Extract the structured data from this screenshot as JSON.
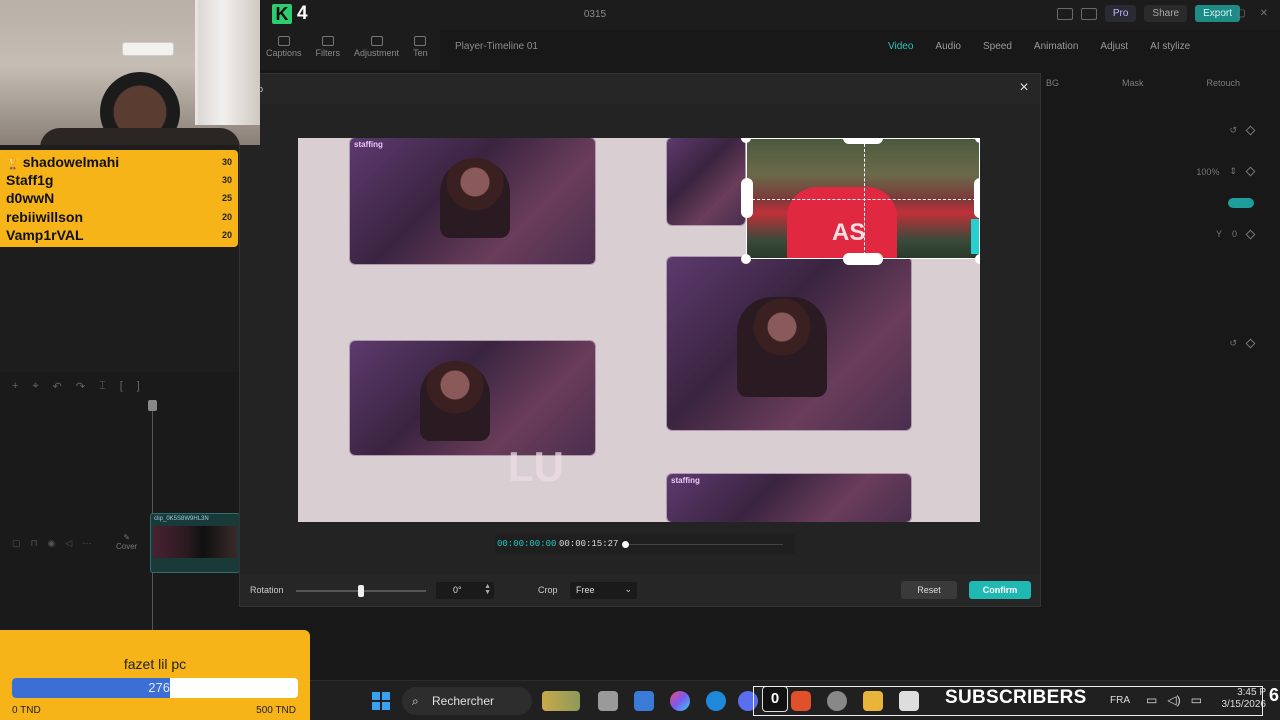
{
  "editor": {
    "kick_count": "4",
    "project_name": "0315",
    "pro_label": "Pro",
    "share_label": "Share",
    "export_label": "Export",
    "tools": [
      "Captions",
      "Filters",
      "Adjustment",
      "Ten"
    ],
    "player_title": "Player-Timeline 01",
    "right_tabs": [
      "Video",
      "Audio",
      "Speed",
      "Animation",
      "Adjust",
      "AI stylize"
    ],
    "subtabs": [
      "BG",
      "Mask",
      "Retouch"
    ],
    "scale_value": "100%",
    "pos_y_label": "Y",
    "pos_y_value": "0",
    "cover_label": "Cover",
    "clip_label": "clip_0K5S8W9HL3N",
    "accent_color": "#25c6c0"
  },
  "crop_dialog": {
    "title": "p",
    "close_icon": "×",
    "overlay_text": "LU",
    "thumb_label": "staffing",
    "time_current": "00:00:00:00",
    "time_total": "00:00:15:27",
    "playback_progress": 0.0,
    "rotation_label": "Rotation",
    "rotation_value": "0°",
    "rotation_slider_level": 0.5,
    "crop_label": "Crop",
    "crop_value": "Free",
    "reset_label": "Reset",
    "confirm_label": "Confirm"
  },
  "leaderboard": [
    {
      "name": "shadowelmahi",
      "points": "30",
      "trophy": true
    },
    {
      "name": "Staff1g",
      "points": "30",
      "trophy": false
    },
    {
      "name": "d0wwN",
      "points": "25",
      "trophy": false
    },
    {
      "name": "rebiiwillson",
      "points": "20",
      "trophy": false
    },
    {
      "name": "Vamp1rVAL",
      "points": "20",
      "trophy": false
    }
  ],
  "goal": {
    "title": "fazet lil pc",
    "current": "276",
    "min_label": "0 TND",
    "max_label": "500 TND",
    "progress": 0.552
  },
  "taskbar": {
    "search_placeholder": "Rechercher",
    "badge_count": "0",
    "subscribers_label": "SUBSCRIBERS",
    "language": "FRA",
    "time": "3:45 P",
    "date": "3/15/2026",
    "overlay_number": "6"
  }
}
